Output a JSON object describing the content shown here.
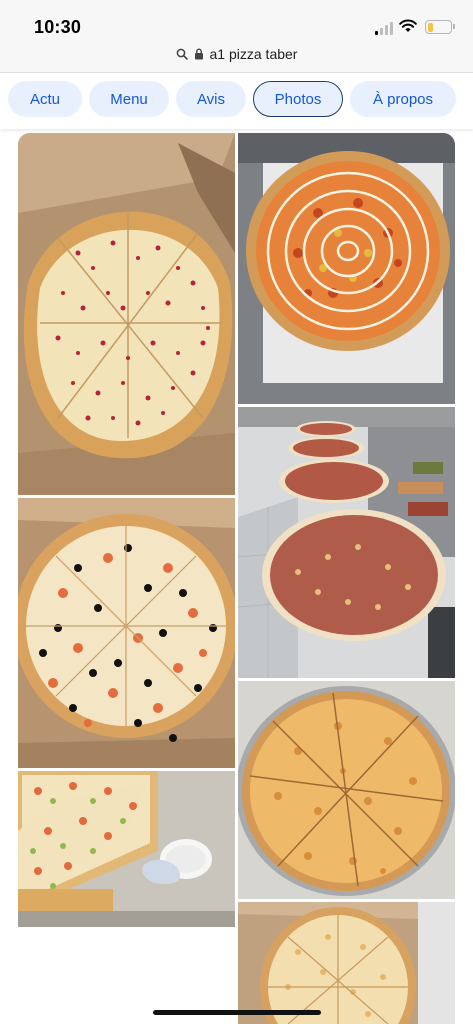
{
  "status_bar": {
    "time": "10:30"
  },
  "address_bar": {
    "url": "a1 pizza taber"
  },
  "tabs": [
    {
      "label": "Actu",
      "active": false
    },
    {
      "label": "Menu",
      "active": false
    },
    {
      "label": "Avis",
      "active": false
    },
    {
      "label": "Photos",
      "active": true
    },
    {
      "label": "À propos",
      "active": false
    }
  ],
  "colors": {
    "chip_bg": "#e8f0fe",
    "chip_text": "#1558d6",
    "active_border": "#1a3f6f"
  },
  "photos": [
    {
      "name": "photo-pizza-pepperoni-bits",
      "subject": "cheese pizza with red pepperoni bits in box"
    },
    {
      "name": "photo-pizza-drizzle",
      "subject": "pizza with tomato, pepper and white sauce drizzle"
    },
    {
      "name": "photo-pizzas-counter",
      "subject": "several pizzas on kitchen counter"
    },
    {
      "name": "photo-pizza-olives",
      "subject": "pizza with black olives and tomato"
    },
    {
      "name": "photo-pizza-cheese-slices",
      "subject": "cheese pizza cut into slices on tray"
    },
    {
      "name": "photo-pizza-vegetable-dip",
      "subject": "vegetable pizza slices with dipping sauce"
    },
    {
      "name": "photo-pizza-cheese-box",
      "subject": "cheese pizza in box"
    }
  ]
}
